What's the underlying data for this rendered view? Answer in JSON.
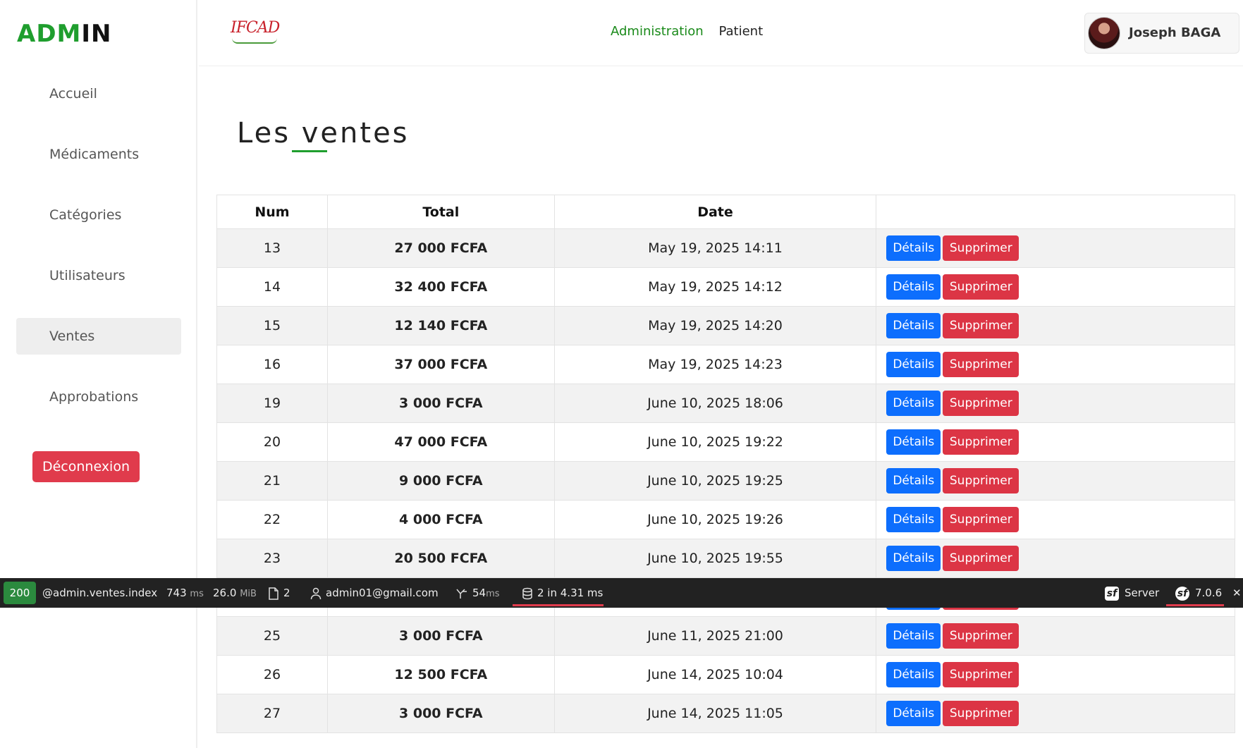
{
  "brand": {
    "part1": "ADM",
    "part2": "I",
    "part3": "N"
  },
  "sidebar": {
    "items": [
      {
        "label": "Accueil"
      },
      {
        "label": "Médicaments"
      },
      {
        "label": "Catégories"
      },
      {
        "label": "Utilisateurs"
      },
      {
        "label": "Ventes",
        "active": true
      },
      {
        "label": "Approbations"
      }
    ],
    "logout_label": "Déconnexion"
  },
  "header": {
    "logo_text": "IFCAD",
    "nav": {
      "administration": "Administration",
      "patient": "Patient"
    },
    "user_name": "Joseph BAGA"
  },
  "main": {
    "title": "Les ventes",
    "columns": [
      "Num",
      "Total",
      "Date",
      ""
    ],
    "rows": [
      {
        "num": "13",
        "total": "27 000 FCFA",
        "date": "May 19, 2025 14:11"
      },
      {
        "num": "14",
        "total": "32 400 FCFA",
        "date": "May 19, 2025 14:12"
      },
      {
        "num": "15",
        "total": "12 140 FCFA",
        "date": "May 19, 2025 14:20"
      },
      {
        "num": "16",
        "total": "37 000 FCFA",
        "date": "May 19, 2025 14:23"
      },
      {
        "num": "19",
        "total": "3 000 FCFA",
        "date": "June 10, 2025 18:06"
      },
      {
        "num": "20",
        "total": "47 000 FCFA",
        "date": "June 10, 2025 19:22"
      },
      {
        "num": "21",
        "total": "9 000 FCFA",
        "date": "June 10, 2025 19:25"
      },
      {
        "num": "22",
        "total": "4 000 FCFA",
        "date": "June 10, 2025 19:26"
      },
      {
        "num": "23",
        "total": "20 500 FCFA",
        "date": "June 10, 2025 19:55"
      },
      {
        "num": "",
        "total": "",
        "date": ""
      },
      {
        "num": "25",
        "total": "3 000 FCFA",
        "date": "June 11, 2025 21:00"
      },
      {
        "num": "26",
        "total": "12 500 FCFA",
        "date": "June 14, 2025 10:04"
      },
      {
        "num": "27",
        "total": "3 000 FCFA",
        "date": "June 14, 2025 11:05"
      }
    ],
    "details_label": "Détails",
    "delete_label": "Supprimer"
  },
  "toolbar": {
    "status": "200",
    "route": "@admin.ventes.index",
    "time": "743",
    "time_unit": "ms",
    "memory": "26.0",
    "memory_unit": "MiB",
    "files": "2",
    "user": "admin01@gmail.com",
    "events": "54",
    "events_unit": "ms",
    "db": "2 in 4.31 ms",
    "server_label": "Server",
    "version": "7.0.6",
    "close": "✕"
  },
  "colors": {
    "brand_green": "#1f9e2e",
    "danger": "#dc3545",
    "primary": "#0d6efd",
    "toolbar_bg": "#222222",
    "status_ok": "#2b8a3e"
  }
}
